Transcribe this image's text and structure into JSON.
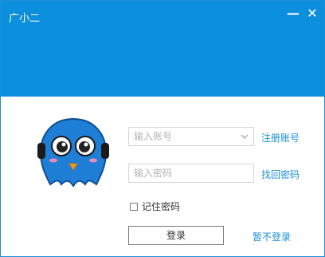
{
  "window": {
    "title": "广小二",
    "minimize_label": "—",
    "close_label": "✕"
  },
  "colors": {
    "header": "#0c8fdd",
    "link": "#1a8fd8"
  },
  "login": {
    "account_placeholder": "输入账号",
    "password_placeholder": "输入密码",
    "register_link": "注册账号",
    "recover_link": "找回密码",
    "remember_label": "记住密码",
    "remember_checked": false,
    "login_button": "登录",
    "skip_link": "暂不登录"
  },
  "icons": {
    "avatar": "blue-owl-mascot-with-headphones-icon",
    "dropdown": "chevron-down-icon"
  }
}
